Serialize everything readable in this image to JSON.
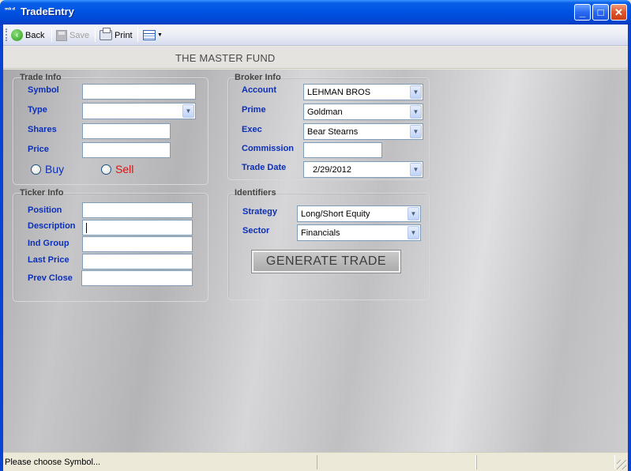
{
  "window": {
    "title": "TradeEntry",
    "icon_text": "ᵐᵏᵈ",
    "minimize_glyph": "_",
    "maximize_glyph": "□",
    "close_glyph": "✕"
  },
  "toolbar": {
    "back_label": "Back",
    "save_label": "Save",
    "print_label": "Print"
  },
  "fund": {
    "title": "THE MASTER FUND"
  },
  "trade_info": {
    "title": "Trade Info",
    "symbol_label": "Symbol",
    "symbol_value": "",
    "type_label": "Type",
    "type_value": "",
    "shares_label": "Shares",
    "shares_value": "",
    "price_label": "Price",
    "price_value": "",
    "buy_label": "Buy",
    "sell_label": "Sell"
  },
  "broker_info": {
    "title": "Broker Info",
    "account_label": "Account",
    "account_value": "LEHMAN BROS",
    "prime_label": "Prime",
    "prime_value": "Goldman",
    "exec_label": "Exec",
    "exec_value": "Bear Stearns",
    "commission_label": "Commission",
    "commission_value": "",
    "trade_date_label": "Trade Date",
    "trade_date_value": "2/29/2012"
  },
  "ticker_info": {
    "title": "Ticker Info",
    "position_label": "Position",
    "position_value": "",
    "description_label": "Description",
    "description_value": "",
    "ind_group_label": "Ind Group",
    "ind_group_value": "",
    "last_price_label": "Last Price",
    "last_price_value": "",
    "prev_close_label": "Prev Close",
    "prev_close_value": ""
  },
  "identifiers": {
    "title": "Identifiers",
    "strategy_label": "Strategy",
    "strategy_value": "Long/Short Equity",
    "sector_label": "Sector",
    "sector_value": "Financials"
  },
  "actions": {
    "generate_label": "GENERATE TRADE"
  },
  "status": {
    "message": "Please choose Symbol..."
  },
  "colors": {
    "label_blue": "#0b2fb8",
    "buy_blue": "#0b2fb8",
    "sell_red": "#e01010",
    "titlebar_blue": "#0054e3"
  }
}
